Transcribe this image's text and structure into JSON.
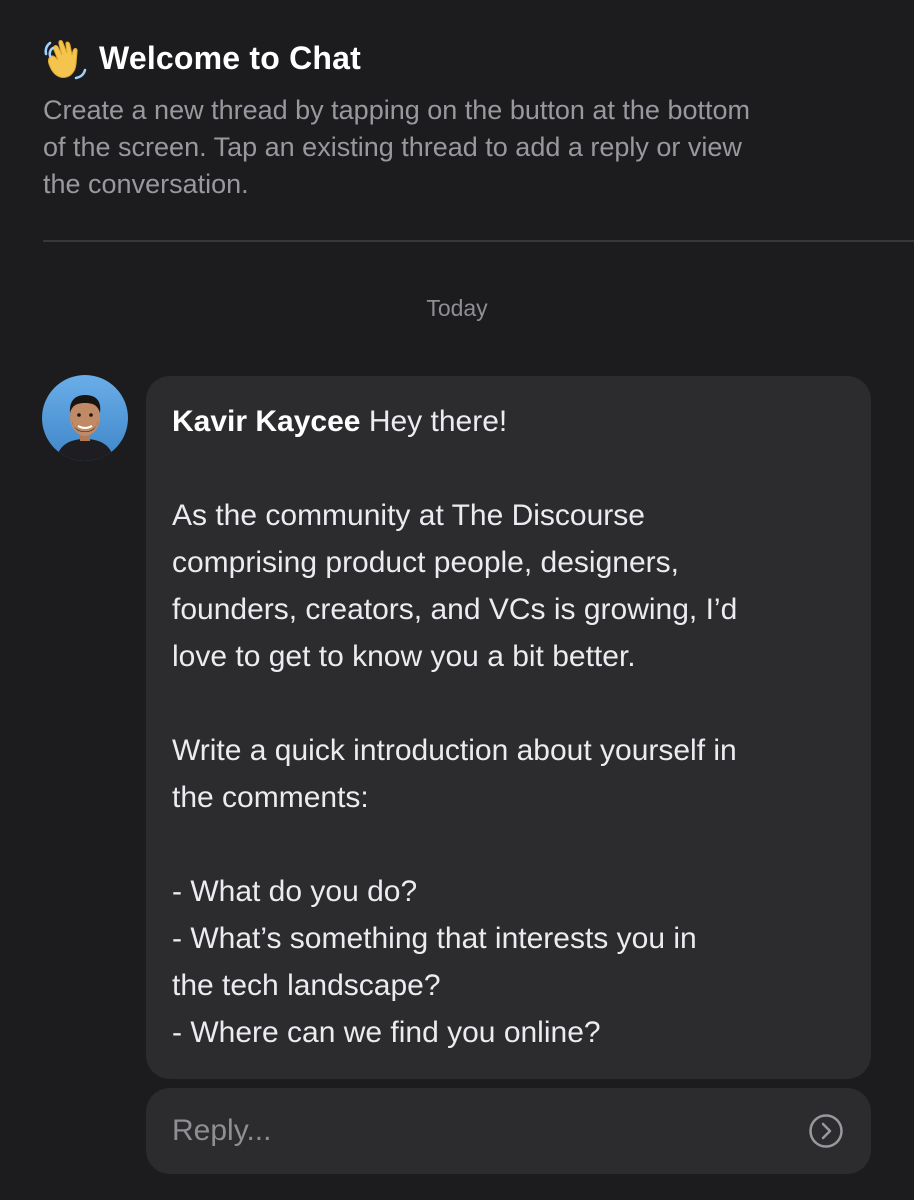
{
  "header": {
    "icon": "waving-hand-icon",
    "title": "Welcome to Chat",
    "subtitle_lines": [
      "Create a new thread by tapping on the button at the bottom",
      "of the screen. Tap an existing thread to add a reply or view",
      "the conversation."
    ]
  },
  "date_separator": "Today",
  "message": {
    "avatar": "user-avatar",
    "author": "Kavir Kaycee",
    "lines": [
      "Hey there!",
      "",
      "As the community at The Discourse",
      "comprising product people, designers,",
      "founders, creators, and VCs is growing, I’d",
      "love to get to know you a bit better.",
      "",
      "Write a quick introduction about yourself in",
      "the comments:",
      "",
      "- What do you do?",
      "- What’s something that interests you in",
      "the tech landscape?",
      "- Where can we find you online?"
    ]
  },
  "reply": {
    "placeholder": "Reply...",
    "value": "",
    "send_icon": "chevron-right-circle-icon"
  },
  "colors": {
    "background": "#1c1c1e",
    "bubble": "#2c2c2e",
    "muted_text": "#98989f",
    "divider": "#38383a"
  }
}
